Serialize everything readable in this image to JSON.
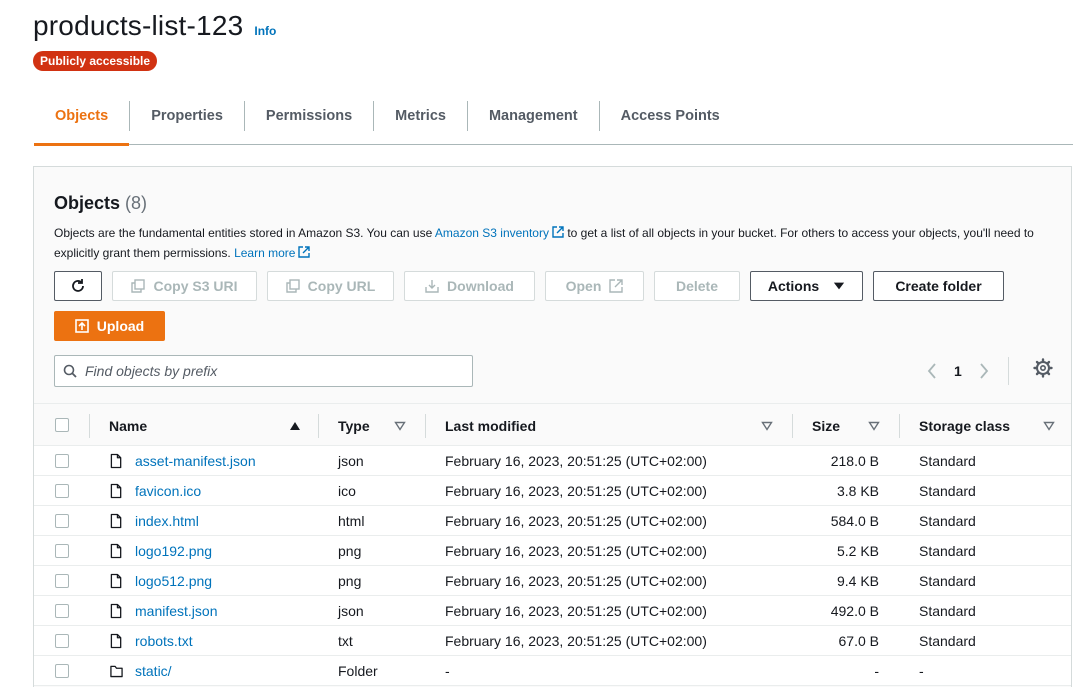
{
  "header": {
    "title": "products-list-123",
    "info": "Info",
    "badge": "Publicly accessible"
  },
  "tabs": [
    {
      "label": "Objects",
      "active": true
    },
    {
      "label": "Properties"
    },
    {
      "label": "Permissions"
    },
    {
      "label": "Metrics"
    },
    {
      "label": "Management"
    },
    {
      "label": "Access Points"
    }
  ],
  "objects_panel": {
    "heading": "Objects",
    "count": "(8)",
    "description_1": "Objects are the fundamental entities stored in Amazon S3. You can use",
    "inventory_link": "Amazon S3 inventory",
    "description_2": "to get a list of all objects in your bucket. For others to access your objects, you'll need to explicitly grant them permissions.",
    "learn_more": "Learn more"
  },
  "toolbar": {
    "copy_s3_uri": "Copy S3 URI",
    "copy_url": "Copy URL",
    "download": "Download",
    "open": "Open",
    "delete": "Delete",
    "actions": "Actions",
    "create_folder": "Create folder",
    "upload": "Upload"
  },
  "search": {
    "placeholder": "Find objects by prefix",
    "value": ""
  },
  "pagination": {
    "page": "1"
  },
  "columns": {
    "name": "Name",
    "type": "Type",
    "last_modified": "Last modified",
    "size": "Size",
    "storage_class": "Storage class"
  },
  "rows": [
    {
      "name": "asset-manifest.json",
      "type": "json",
      "modified": "February 16, 2023, 20:51:25 (UTC+02:00)",
      "size": "218.0 B",
      "storage": "Standard",
      "icon": "file-icon"
    },
    {
      "name": "favicon.ico",
      "type": "ico",
      "modified": "February 16, 2023, 20:51:25 (UTC+02:00)",
      "size": "3.8 KB",
      "storage": "Standard",
      "icon": "file-icon"
    },
    {
      "name": "index.html",
      "type": "html",
      "modified": "February 16, 2023, 20:51:25 (UTC+02:00)",
      "size": "584.0 B",
      "storage": "Standard",
      "icon": "file-icon"
    },
    {
      "name": "logo192.png",
      "type": "png",
      "modified": "February 16, 2023, 20:51:25 (UTC+02:00)",
      "size": "5.2 KB",
      "storage": "Standard",
      "icon": "file-icon"
    },
    {
      "name": "logo512.png",
      "type": "png",
      "modified": "February 16, 2023, 20:51:25 (UTC+02:00)",
      "size": "9.4 KB",
      "storage": "Standard",
      "icon": "file-icon"
    },
    {
      "name": "manifest.json",
      "type": "json",
      "modified": "February 16, 2023, 20:51:25 (UTC+02:00)",
      "size": "492.0 B",
      "storage": "Standard",
      "icon": "file-icon"
    },
    {
      "name": "robots.txt",
      "type": "txt",
      "modified": "February 16, 2023, 20:51:25 (UTC+02:00)",
      "size": "67.0 B",
      "storage": "Standard",
      "icon": "file-icon"
    },
    {
      "name": "static/",
      "type": "Folder",
      "modified": "-",
      "size": "-",
      "storage": "-",
      "icon": "folder-icon"
    }
  ],
  "colors": {
    "accent": "#ec7211",
    "link": "#0073bb",
    "badge": "#d13212"
  }
}
